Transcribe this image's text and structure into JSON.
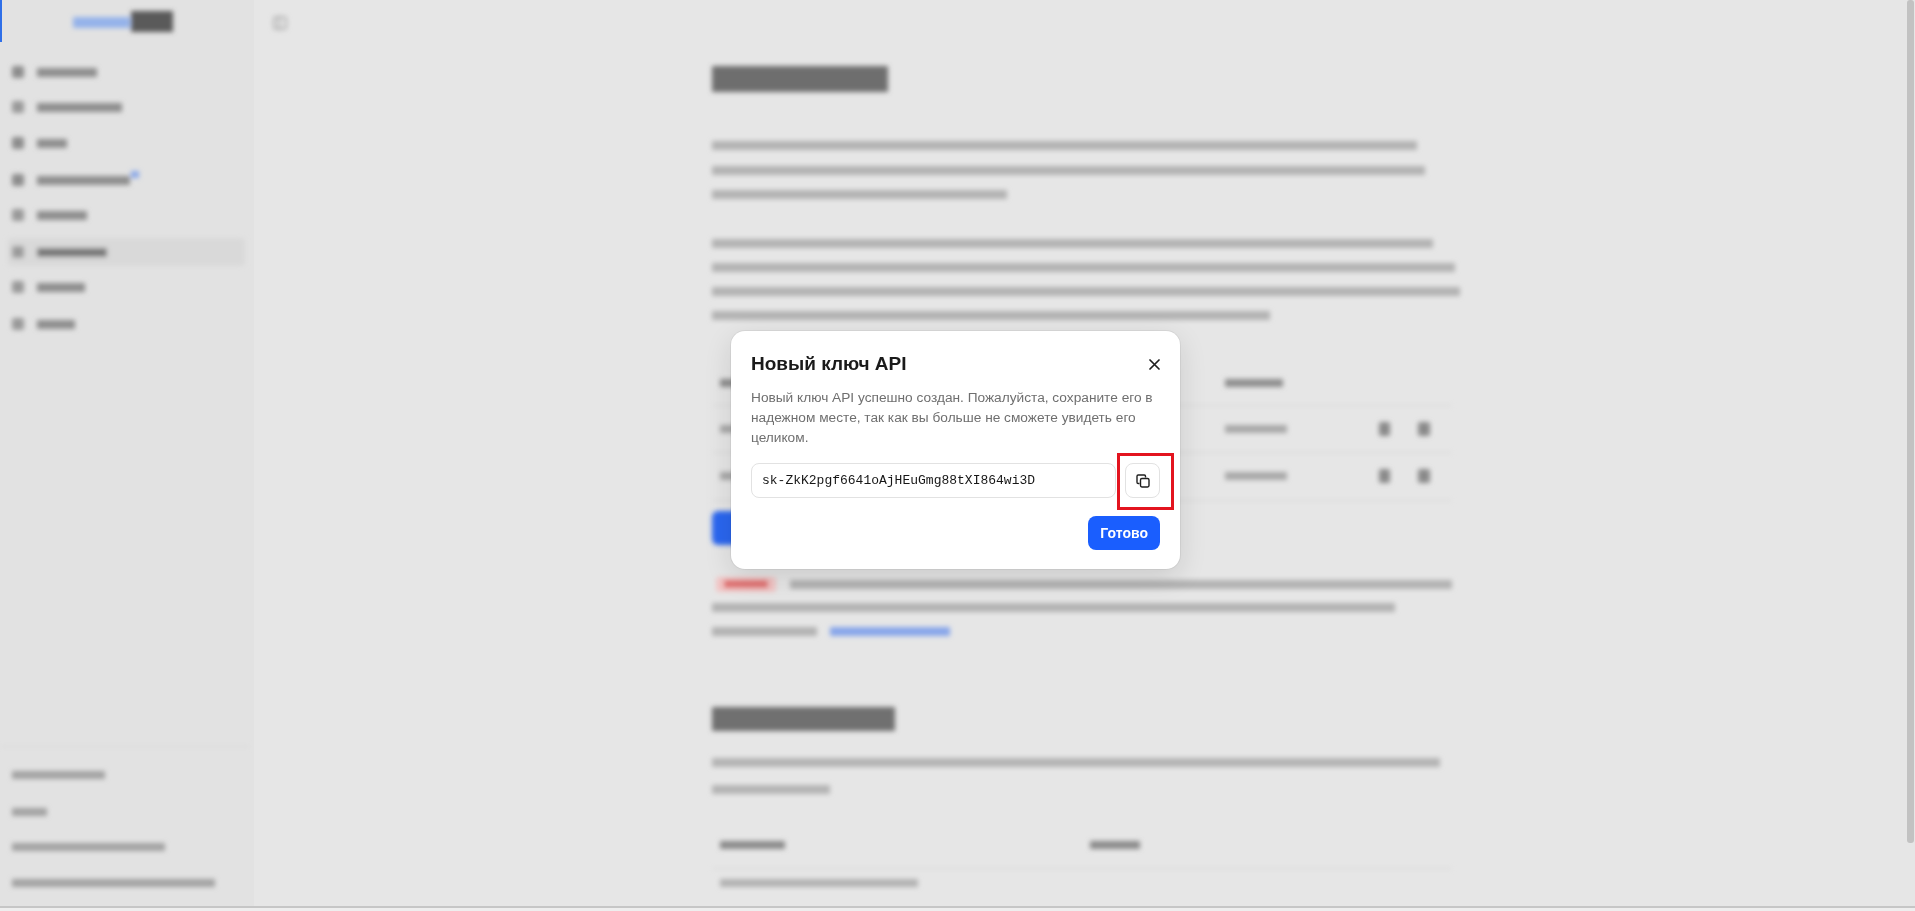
{
  "dialog": {
    "title": "Новый ключ API",
    "description": "Новый ключ API успешно создан. Пожалуйста, сохраните его в надежном месте, так как вы больше не сможете увидеть его целиком.",
    "key_field": {
      "value": "sk-ZkK2pgf6641oAjHEuGmg88tXI864wi3D"
    },
    "copy_button": {
      "highlighted": true
    },
    "buttons": [
      {
        "label": "Готово",
        "kind": "primary"
      }
    ]
  }
}
